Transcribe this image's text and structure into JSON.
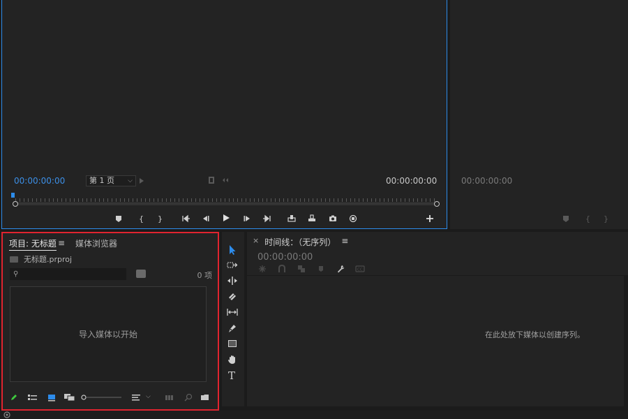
{
  "source_monitor": {
    "timecode_in": "00:00:00:00",
    "timecode_out": "00:00:00:00",
    "page_select": "第 1 页"
  },
  "program_monitor": {
    "timecode": "00:00:00:00"
  },
  "project_panel": {
    "tab_project": "项目: 无标题",
    "tab_media_browser": "媒体浏览器",
    "project_file": "无标题.prproj",
    "search_placeholder": "",
    "item_count": "0 项",
    "drop_hint": "导入媒体以开始"
  },
  "timeline": {
    "close": "×",
    "title": "时间线：（无序列）",
    "timecode": "00:00:00:00",
    "drop_hint": "在此处放下媒体以创建序列。"
  },
  "colors": {
    "accent": "#2d8ceb",
    "highlight_border": "#e0242f",
    "panel_bg": "#232323",
    "app_bg": "#1b1b1b"
  }
}
